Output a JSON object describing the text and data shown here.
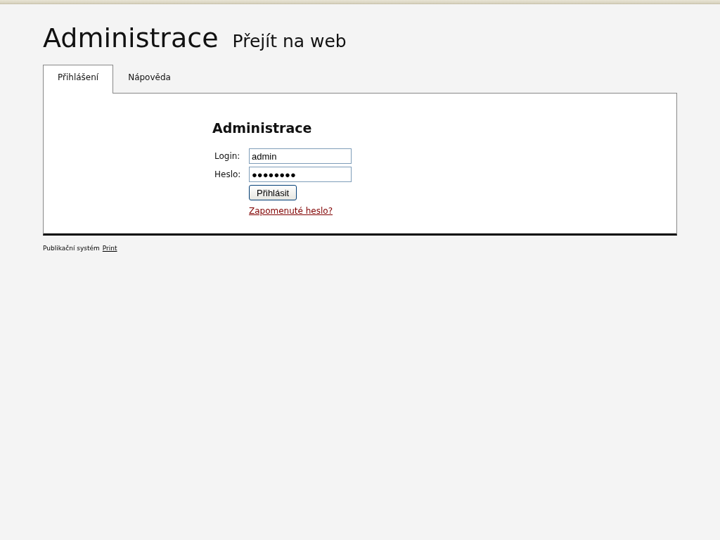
{
  "header": {
    "title": "Administrace",
    "web_link": "Přejít na web"
  },
  "tabs": [
    {
      "label": "Přihlášení",
      "selected": true
    },
    {
      "label": "Nápověda",
      "selected": false
    }
  ],
  "login_form": {
    "heading": "Administrace",
    "fields": [
      {
        "label": "Login:",
        "value": "admin"
      },
      {
        "label": "Heslo:",
        "value": "●●●●●●●●"
      }
    ],
    "submit": "Přihlásit",
    "forgot_link": "Zapomenuté heslo?"
  },
  "footer": {
    "text": "Publikační systém",
    "link": "Print"
  }
}
